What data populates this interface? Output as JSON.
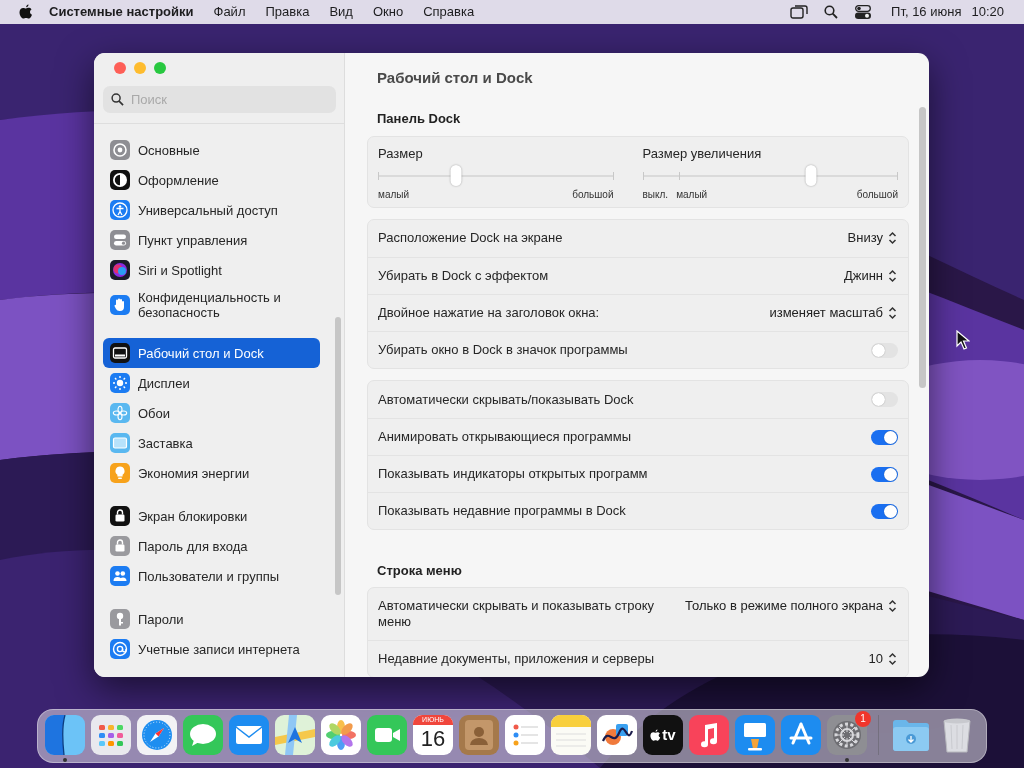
{
  "menu_bar": {
    "app_name": "Системные настройки",
    "menus": [
      "Файл",
      "Правка",
      "Вид",
      "Окно",
      "Справка"
    ],
    "date": "Пт, 16 июня",
    "time": "10:20"
  },
  "window": {
    "search": {
      "placeholder": "Поиск"
    },
    "sidebar": {
      "groups": [
        {
          "items": [
            {
              "label": "Основные",
              "kind": "general",
              "selected": false
            },
            {
              "label": "Оформление",
              "kind": "appearance",
              "selected": false
            },
            {
              "label": "Универсальный доступ",
              "kind": "accessibility",
              "selected": false
            },
            {
              "label": "Пункт управления",
              "kind": "control",
              "selected": false
            },
            {
              "label": "Siri и Spotlight",
              "kind": "siri",
              "selected": false
            },
            {
              "label": "Конфиденциальность и безопасность",
              "kind": "privacy",
              "selected": false
            }
          ]
        },
        {
          "items": [
            {
              "label": "Рабочий стол и Dock",
              "kind": "desktop",
              "selected": true
            },
            {
              "label": "Дисплеи",
              "kind": "displays",
              "selected": false
            },
            {
              "label": "Обои",
              "kind": "wallpaper",
              "selected": false
            },
            {
              "label": "Заставка",
              "kind": "screensaver",
              "selected": false
            },
            {
              "label": "Экономия энергии",
              "kind": "energy",
              "selected": false
            }
          ]
        },
        {
          "items": [
            {
              "label": "Экран блокировки",
              "kind": "lockscreen",
              "selected": false
            },
            {
              "label": "Пароль для входа",
              "kind": "password",
              "selected": false
            },
            {
              "label": "Пользователи и группы",
              "kind": "users",
              "selected": false
            }
          ]
        },
        {
          "items": [
            {
              "label": "Пароли",
              "kind": "passwords",
              "selected": false
            },
            {
              "label": "Учетные записи интернета",
              "kind": "internet",
              "selected": false
            }
          ]
        }
      ]
    },
    "title": "Рабочий стол и Dock",
    "sections": [
      {
        "heading": "Панель Dock",
        "cards": [
          {
            "kind": "sliders",
            "sliders": [
              {
                "label": "Размер",
                "level": 0.33,
                "scale": [
                  "малый",
                  "большой"
                ]
              },
              {
                "label": "Размер увеличения",
                "level": 0.66,
                "scale": [
                  "выкл.",
                  "малый",
                  "большой"
                ]
              }
            ]
          },
          {
            "kind": "rows",
            "rows": [
              {
                "kind": "select",
                "label": "Расположение Dock на экране",
                "value": "Внизу"
              },
              {
                "kind": "select",
                "label": "Убирать в Dock с эффектом",
                "value": "Джинн"
              },
              {
                "kind": "select",
                "label": "Двойное нажатие на заголовок окна:",
                "value": "изменяет масштаб"
              },
              {
                "kind": "toggle",
                "label": "Убирать окно в Dock в значок программы",
                "on": false
              }
            ]
          },
          {
            "kind": "rows",
            "rows": [
              {
                "kind": "toggle",
                "label": "Автоматически скрывать/показывать Dock",
                "on": false
              },
              {
                "kind": "toggle",
                "label": "Анимировать открывающиеся программы",
                "on": true
              },
              {
                "kind": "toggle",
                "label": "Показывать индикаторы открытых программ",
                "on": true
              },
              {
                "kind": "toggle",
                "label": "Показывать недавние программы в Dock",
                "on": true
              }
            ]
          }
        ]
      },
      {
        "heading": "Строка меню",
        "cards": [
          {
            "kind": "rows",
            "rows": [
              {
                "kind": "select",
                "label": "Автоматически скрывать и показывать строку меню",
                "value": "Только в режиме полного экрана"
              },
              {
                "kind": "select",
                "label": "Недавние документы, приложения и серверы",
                "value": "10"
              }
            ]
          }
        ]
      }
    ]
  },
  "dock": {
    "apps": [
      {
        "kind": "finder",
        "running": true
      },
      {
        "kind": "launchpad",
        "running": false
      },
      {
        "kind": "safari",
        "running": false
      },
      {
        "kind": "messages",
        "running": false
      },
      {
        "kind": "mail",
        "running": false
      },
      {
        "kind": "maps",
        "running": false
      },
      {
        "kind": "photos",
        "running": false
      },
      {
        "kind": "facetime",
        "running": false
      },
      {
        "kind": "calendar",
        "running": false,
        "month": "ИЮНЬ",
        "day": "16"
      },
      {
        "kind": "contacts",
        "running": false
      },
      {
        "kind": "reminders",
        "running": false
      },
      {
        "kind": "notes",
        "running": false
      },
      {
        "kind": "freeform",
        "running": false
      },
      {
        "kind": "tv",
        "running": false,
        "label": "tv"
      },
      {
        "kind": "music",
        "running": false
      },
      {
        "kind": "keynote",
        "running": false
      },
      {
        "kind": "appstore",
        "running": false
      },
      {
        "kind": "settings",
        "running": true,
        "badge": "1"
      }
    ],
    "stacks": [
      {
        "kind": "downloads"
      },
      {
        "kind": "trash"
      }
    ]
  }
}
